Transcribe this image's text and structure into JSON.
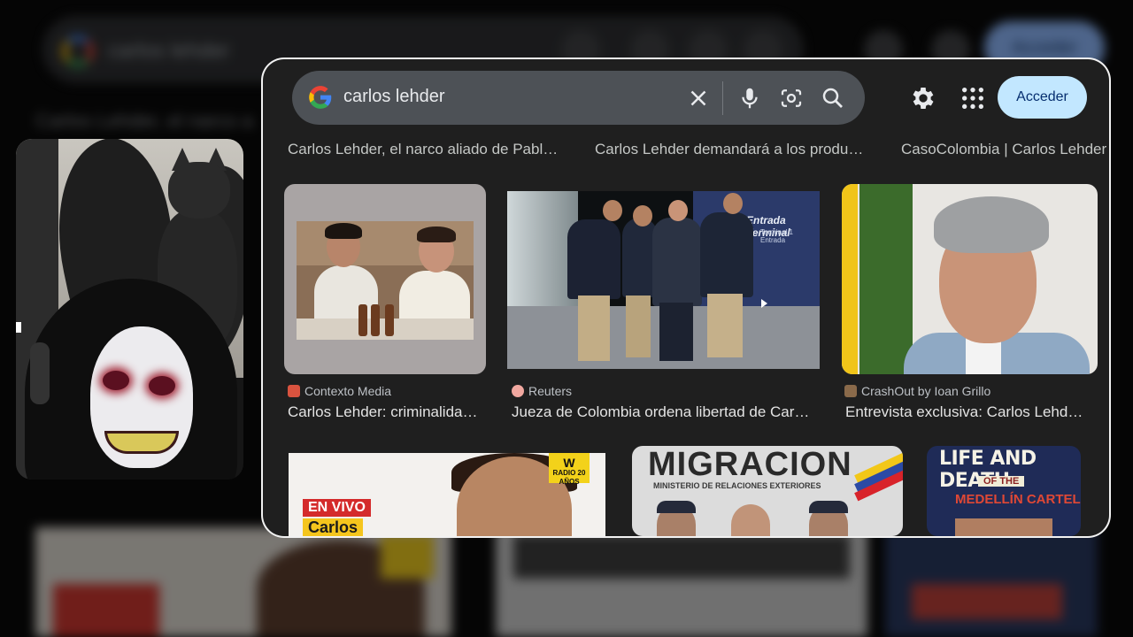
{
  "background": {
    "query": "carlos lehder",
    "signin_label": "Acceder",
    "caption": "Carlos Lehder, el narco a"
  },
  "search": {
    "query": "carlos lehder",
    "clear_icon": "close-icon",
    "mic_icon": "microphone-icon",
    "lens_icon": "google-lens-icon",
    "search_icon": "search-icon"
  },
  "header": {
    "settings_icon": "gear-icon",
    "apps_icon": "apps-grid-icon",
    "signin_label": "Acceder"
  },
  "top_captions": [
    "Carlos Lehder, el narco aliado de Pabl…",
    "Carlos Lehder demandará a los produ…",
    "CasoColombia | Carlos Lehder"
  ],
  "results": [
    {
      "source": "Contexto Media",
      "title": "Carlos Lehder: criminalida…"
    },
    {
      "source": "Reuters",
      "title": "Jueza de Colombia ordena libertad de Car…"
    },
    {
      "source": "CrashOut by Ioan Grillo",
      "title": "Entrevista exclusiva: Carlos Lehd…"
    }
  ],
  "image_text": {
    "airport_sign": "Entrada Terminal",
    "airport_sign_sub": "Terminal 1 Entrada",
    "en_vivo": "EN VIVO",
    "carlos": "Carlos",
    "w_logo": "W",
    "w_logo_sub": "RADIO 20 AÑOS",
    "migracion": "MIGRACION",
    "ministerio": "MINISTERIO DE RELACIONES EXTERIORES",
    "life_and_death": "LIFE AND DEATH",
    "of_the": "OF THE",
    "medellin_cartel": "MEDELLÍN CARTEL"
  },
  "colors": {
    "modal_bg": "#1f1f1f",
    "searchbar_bg": "#4d5156",
    "signin_bg": "#c2e7ff",
    "signin_text": "#062e6f"
  }
}
